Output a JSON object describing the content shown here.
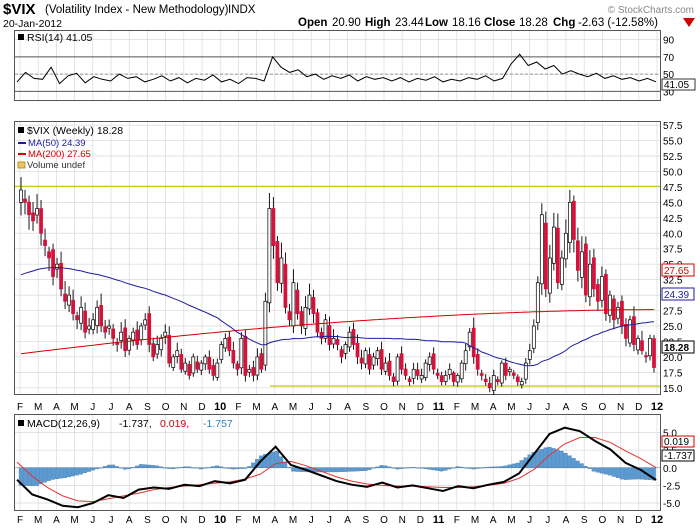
{
  "header": {
    "symbol": "$VIX",
    "name": "(Volatility Index - New Methodology)",
    "exchange": "INDX",
    "date": "20-Jan-2012",
    "open_label": "Open",
    "open": "20.90",
    "high_label": "High",
    "high": "23.44",
    "low_label": "Low",
    "low": "18.16",
    "close_label": "Close",
    "close": "18.28",
    "chg_label": "Chg",
    "chg": "-2.63 (-12.58%)",
    "chg_icon": "down-triangle-icon",
    "watermark": "© StockCharts.com"
  },
  "rsi": {
    "legend": "RSI(14) 41.05",
    "last_label": "41.05",
    "ticks": [
      "90",
      "70",
      "50",
      "30"
    ]
  },
  "price": {
    "legend_main": "$VIX (Weekly) 18.28",
    "legend_ma50": "MA(50) 24.39",
    "legend_ma200": "MA(200) 27.65",
    "legend_volume": "Volume undef",
    "ticks": [
      "57.5",
      "55.0",
      "52.5",
      "50.0",
      "47.5",
      "45.0",
      "42.5",
      "40.0",
      "37.5",
      "35.0",
      "32.5",
      "30.0",
      "27.5",
      "25.0",
      "22.5",
      "20.0",
      "17.5",
      "15.0"
    ],
    "badge_ma200": "27.65",
    "badge_ma50": "24.39",
    "badge_close": "18.28"
  },
  "macd": {
    "legend_name": "MACD(12,26,9)",
    "legend_macd": "-1.737,",
    "legend_signal": "0.019,",
    "legend_hist": "-1.757",
    "ticks": [
      "5.0",
      "2.5",
      "0.0",
      "-2.5",
      "-5.0"
    ],
    "badge_signal": "0.019",
    "badge_macd": "-1.737"
  },
  "x_axis": {
    "months": [
      "F",
      "M",
      "A",
      "M",
      "J",
      "J",
      "A",
      "S",
      "O",
      "N",
      "D",
      "10",
      "F",
      "M",
      "A",
      "M",
      "J",
      "J",
      "A",
      "S",
      "O",
      "N",
      "D",
      "11",
      "F",
      "M",
      "A",
      "M",
      "J",
      "J",
      "A",
      "S",
      "O",
      "N",
      "D",
      "12"
    ]
  },
  "colors": {
    "up": "#ffffff",
    "down": "#d4123b",
    "ma50": "#1c1c9e",
    "ma200": "#d40000",
    "hist": "#5b9bd5",
    "signal": "#e23232",
    "grid": "#d9d9d9",
    "guide": "#c8c800"
  },
  "chart_data": {
    "type": "candlestick",
    "title": "$VIX (Volatility Index - New Methodology) INDX",
    "period": "Weekly",
    "x_start": "2009-01-23",
    "x_end": "2012-01-20",
    "price_ylim": [
      14,
      58
    ],
    "rsi_ylim": [
      20,
      100
    ],
    "macd_ylim": [
      -6,
      7.5
    ],
    "anchors": {
      "close": [
        47,
        45,
        43,
        42,
        44,
        40,
        38,
        36,
        33,
        35,
        31,
        29,
        30,
        27,
        26,
        28,
        24,
        25,
        26,
        28,
        25,
        24,
        25,
        23,
        22,
        24,
        21,
        23,
        24,
        22,
        25,
        26,
        22,
        20,
        22,
        23,
        24,
        19,
        20,
        21,
        18,
        19,
        17,
        20,
        18,
        19,
        20,
        18,
        17,
        19,
        22,
        23,
        21,
        19,
        18,
        23,
        17,
        18,
        17,
        20,
        18,
        29,
        44,
        38,
        32,
        36,
        28,
        26,
        32,
        27,
        25,
        28,
        30,
        27,
        24,
        23,
        26,
        22,
        23,
        22,
        20,
        22,
        24,
        22,
        20,
        19,
        21,
        18,
        20,
        21,
        18,
        19,
        17,
        16,
        20,
        18,
        17,
        16,
        18,
        17,
        17,
        19,
        20,
        18,
        17,
        16,
        17,
        18,
        16,
        17,
        19,
        21,
        24,
        20,
        18,
        17,
        16,
        15,
        17,
        16,
        19,
        17,
        18,
        17,
        16,
        16,
        19,
        21,
        25,
        32,
        43,
        31,
        36,
        41,
        32,
        36,
        40,
        45,
        39,
        34,
        37,
        30,
        35,
        31,
        29,
        33,
        27,
        30,
        26,
        28,
        25,
        23,
        26,
        22,
        23,
        21,
        20,
        23,
        18.28
      ],
      "ma50": [
        33,
        24.4
      ],
      "ma200": [
        20.5,
        27.65
      ]
    },
    "rsi": [
      41,
      52,
      45,
      44,
      58,
      39,
      48,
      51,
      40,
      47,
      44,
      42,
      50,
      45,
      47,
      41,
      44,
      48,
      42,
      46,
      40,
      45,
      43,
      49,
      41,
      44,
      39,
      46,
      45,
      42,
      70,
      58,
      52,
      55,
      47,
      50,
      44,
      48,
      45,
      49,
      42,
      47,
      44,
      46,
      42,
      46,
      41,
      45,
      43,
      47,
      41,
      44,
      42,
      46,
      44,
      48,
      42,
      45,
      62,
      73,
      60,
      64,
      56,
      60,
      50,
      54,
      50,
      47,
      51,
      45,
      48,
      44,
      46,
      42,
      45,
      41.05
    ],
    "macd_line": [
      -1.7,
      -3.8,
      -4.5,
      -5.4,
      -5.6,
      -5.0,
      -3.9,
      -4.3,
      -3.1,
      -2.8,
      -3.0,
      -2.4,
      -2.6,
      -1.9,
      -2.2,
      -1.7,
      0.9,
      3.0,
      0.4,
      -0.3,
      -1.1,
      -1.9,
      -2.4,
      -2.7,
      -2.1,
      -2.8,
      -2.5,
      -2.9,
      -3.3,
      -2.6,
      -2.9,
      -2.4,
      -2.0,
      -0.8,
      2.0,
      4.8,
      5.7,
      5.2,
      3.8,
      2.6,
      0.7,
      -0.3,
      -1.737
    ],
    "signal_line": [
      0.8,
      -1.2,
      -2.8,
      -4.0,
      -4.7,
      -4.8,
      -4.4,
      -4.0,
      -3.6,
      -3.1,
      -2.8,
      -2.6,
      -2.4,
      -2.2,
      -2.0,
      -1.6,
      -0.9,
      0.6,
      0.9,
      0.3,
      -0.5,
      -1.3,
      -1.9,
      -2.3,
      -2.5,
      -2.6,
      -2.6,
      -2.7,
      -2.8,
      -2.8,
      -2.7,
      -2.5,
      -2.2,
      -1.5,
      -0.2,
      1.8,
      3.4,
      4.3,
      4.3,
      3.6,
      2.4,
      1.3,
      0.019
    ],
    "hist_last": -1.757
  }
}
